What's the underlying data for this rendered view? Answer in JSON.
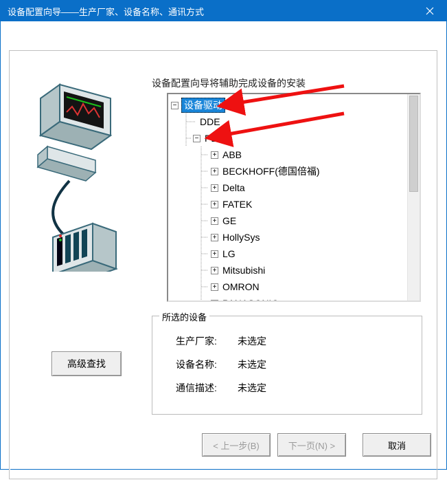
{
  "window": {
    "title": "设备配置向导——生产厂家、设备名称、通讯方式"
  },
  "instruction": "设备配置向导将辅助完成设备的安装",
  "tree": {
    "root": {
      "label": "设备驱动",
      "expanded": true,
      "selected": true
    },
    "child_dde": {
      "label": "DDE"
    },
    "child_plc": {
      "label": "PLC",
      "expanded": true
    },
    "plc_children": [
      "ABB",
      "BECKHOFF(德国倍福)",
      "Delta",
      "FATEK",
      "GE",
      "HollySys",
      "LG",
      "Mitsubishi",
      "OMRON",
      "PANASONIC"
    ]
  },
  "selected_group": {
    "legend": "所选的设备",
    "rows": [
      {
        "label": "生产厂家:",
        "value": "未选定"
      },
      {
        "label": "设备名称:",
        "value": "未选定"
      },
      {
        "label": "通信描述:",
        "value": "未选定"
      }
    ]
  },
  "buttons": {
    "advanced_search": "高级查找",
    "prev": "< 上一步(B)",
    "next": "下一页(N) >",
    "cancel": "取消"
  },
  "annotations": {
    "arrow_color": "#e11"
  }
}
